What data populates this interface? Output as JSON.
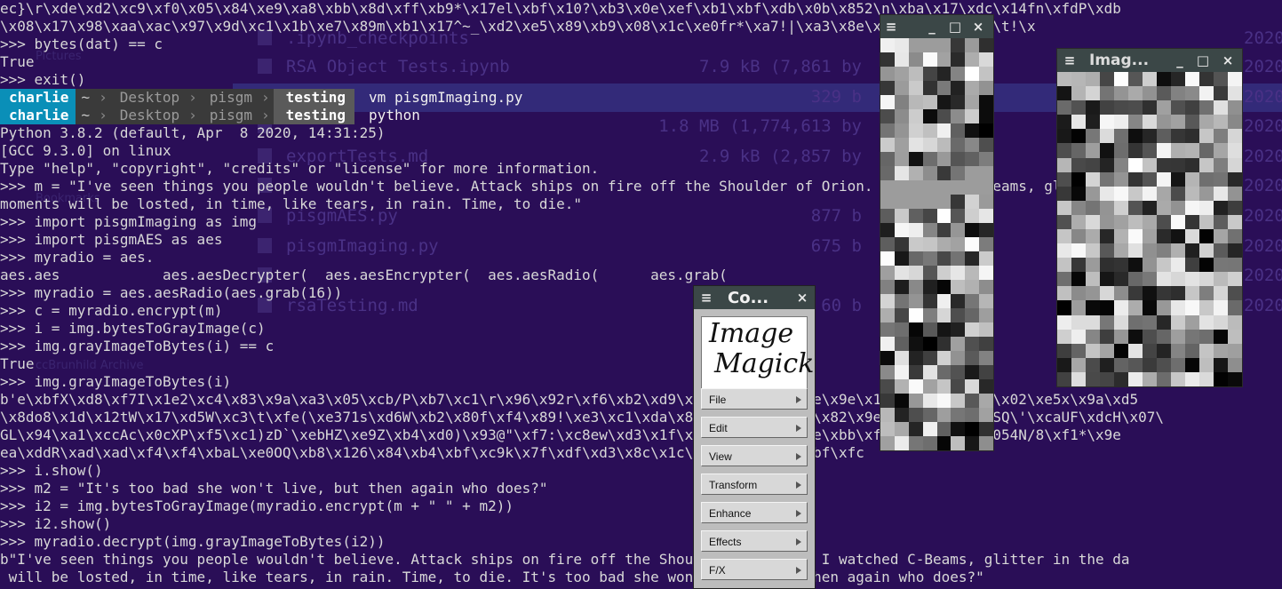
{
  "file_manager": {
    "rows": [
      {
        "name": ".ipynb_checkpoints",
        "size": "",
        "date": "2020"
      },
      {
        "name": "RSA Object Tests.ipynb",
        "size": "7.9 kB (7,861 by",
        "date": "2020"
      },
      {
        "name": "",
        "size": "329 b",
        "date": "2020"
      },
      {
        "name": "",
        "size": "1.8 MB (1,774,613 by",
        "date": "2020"
      },
      {
        "name": "exportTests.md",
        "size": "2.9 kB (2,857 by",
        "date": "2020"
      },
      {
        "name": "",
        "size": "",
        "date": "2020"
      },
      {
        "name": "pisgmAES.py",
        "size": "877 b",
        "date": "2020"
      },
      {
        "name": "pisgmImaging.py",
        "size": "675 b",
        "date": "2020"
      },
      {
        "name": "",
        "size": "",
        "date": "2020"
      },
      {
        "name": "rsaTesting.md",
        "size": "60 b",
        "date": "2020"
      }
    ],
    "side_items": [
      "Pictures",
      "Bookmarks",
      "ccBrunhild Archive"
    ]
  },
  "terminal": {
    "lines": [
      "ec}\\r\\xde\\xd2\\xc9\\xf0\\x05\\x84\\xe9\\xa8\\xbb\\x8d\\xff\\xb9*\\x17el\\xbf\\x10?\\xb3\\x0e\\xef\\xb1\\xbf\\xdb\\x0b\\x852\\n\\xba\\x17\\xdc\\x14fn\\xfdP\\xdb",
      "\\x08\\x17\\x98\\xaa\\xac\\x97\\x9d\\xc1\\x1b\\xe7\\x89m\\xb1\\x17^~_\\xd2\\xe5\\x89\\xb9\\x08\\x1c\\xe0fr*\\xa7!|\\xa3\\x8e\\x8aV0\\xacv\\xf1\\t!\\x",
      ">>> bytes(dat) == c",
      "True",
      ">>> exit()",
      "",
      "",
      "Python 3.8.2 (default, Apr  8 2020, 14:31:25)",
      "[GCC 9.3.0] on linux",
      "Type \"help\", \"copyright\", \"credits\" or \"license\" for more information.",
      ">>> m = \"I've seen things you people wouldn't believe. Attack ships on fire off the Shoulder of Orion. I watched C-Beams, glitter in the",
      "moments will be losted, in time, like tears, in rain. Time, to die.\"",
      ">>> import pisgmImaging as img",
      ">>> import pisgmAES as aes",
      ">>> myradio = aes.",
      "aes.aes            aes.aesDecrypter(  aes.aesEncrypter(  aes.aesRadio(      aes.grab(",
      ">>> myradio = aes.aesRadio(aes.grab(16))",
      ">>> c = myradio.encrypt(m)",
      ">>> i = img.bytesToGrayImage(c)",
      ">>> img.grayImageToBytes(i) == c",
      "True",
      ">>> img.grayImageToBytes(i)",
      "b'e\\xbfX\\xd8\\xf7I\\x1e2\\xc4\\x83\\x9a\\xa3\\x05\\xcb/P\\xb7\\xc1\\r\\x96\\x92r\\xf6\\xb2\\xd9\\x17\\xd1Y\\xc8\\x1e\\x9e\\x1b\\xaa\\xe1\\xc0\\x02\\xe5x\\x9a\\xd5",
      "\\x8do8\\x1d\\x12tW\\x17\\xd5W\\xc3\\t\\xfe(\\xe371s\\xd6W\\xb2\\x80f\\xf4\\x89!\\xe3\\xc1\\xda\\x8b\\x9c\\xf82\\xdc\\x82\\x9e\\xe4\\xb5D\\x08SQ\\'\\xcaUF\\xdcH\\x07\\",
      "GL\\x94\\xa1\\xccAc\\x0cXP\\xf5\\xc1)zD`\\xebHZ\\xe9Z\\xb4\\xd0)\\x93@\"\\xf7:\\xc8ew\\xd3\\x1f\\x1a\\xf7\\x17G\\x8e\\xbb\\xfb`\\x93\\xd0i\\x054N/8\\xf1*\\x9e",
      "ea\\xddR\\xad\\xad\\xf4\\xf4\\xbaL\\xe0OQ\\xb8\\x126\\x84\\xb4\\xbf\\xc9k\\x7f\\xdf\\xd3\\x8c\\x1c\\x81\\xf0\\x10Z\\xbf\\xfc",
      ">>> i.show()",
      ">>> m2 = \"It's too bad she won't live, but then again who does?\"",
      ">>> i2 = img.bytesToGrayImage(myradio.encrypt(m + \" \" + m2))",
      ">>> i2.show()",
      ">>> myradio.decrypt(img.grayImageToBytes(i2))",
      "b\"I've seen things you people wouldn't believe. Attack ships on fire off the Shoulder of Orion. I watched C-Beams, glitter in the da",
      " will be losted, in time, like tears, in rain. Time, to die. It's too bad she won't live, but then again who does?\""
    ],
    "prompts": [
      {
        "user": "charlie",
        "tilde": "~",
        "path": [
          "Desktop",
          "pisgm"
        ],
        "branch": "testing",
        "command": "vm pisgmImaging.py"
      },
      {
        "user": "charlie",
        "tilde": "~",
        "path": [
          "Desktop",
          "pisgm"
        ],
        "branch": "testing",
        "command": "python"
      }
    ]
  },
  "image_windows": [
    {
      "title": "",
      "menu_icon": "≡",
      "min": "_",
      "max": "□",
      "close": "×"
    },
    {
      "title": "Imag...",
      "menu_icon": "≡",
      "min": "_",
      "max": "□",
      "close": "×"
    }
  ],
  "imagemagick": {
    "title": "Co...",
    "menu_icon": "≡",
    "close": "×",
    "logo_line1": "Image",
    "logo_line2": "Magick",
    "buttons": [
      "File",
      "Edit",
      "View",
      "Transform",
      "Enhance",
      "Effects",
      "F/X"
    ]
  },
  "colors": {
    "background": "#2a0e57",
    "prompt_user": "#0a8fb8",
    "terminal_text": "#d8d8d8"
  }
}
